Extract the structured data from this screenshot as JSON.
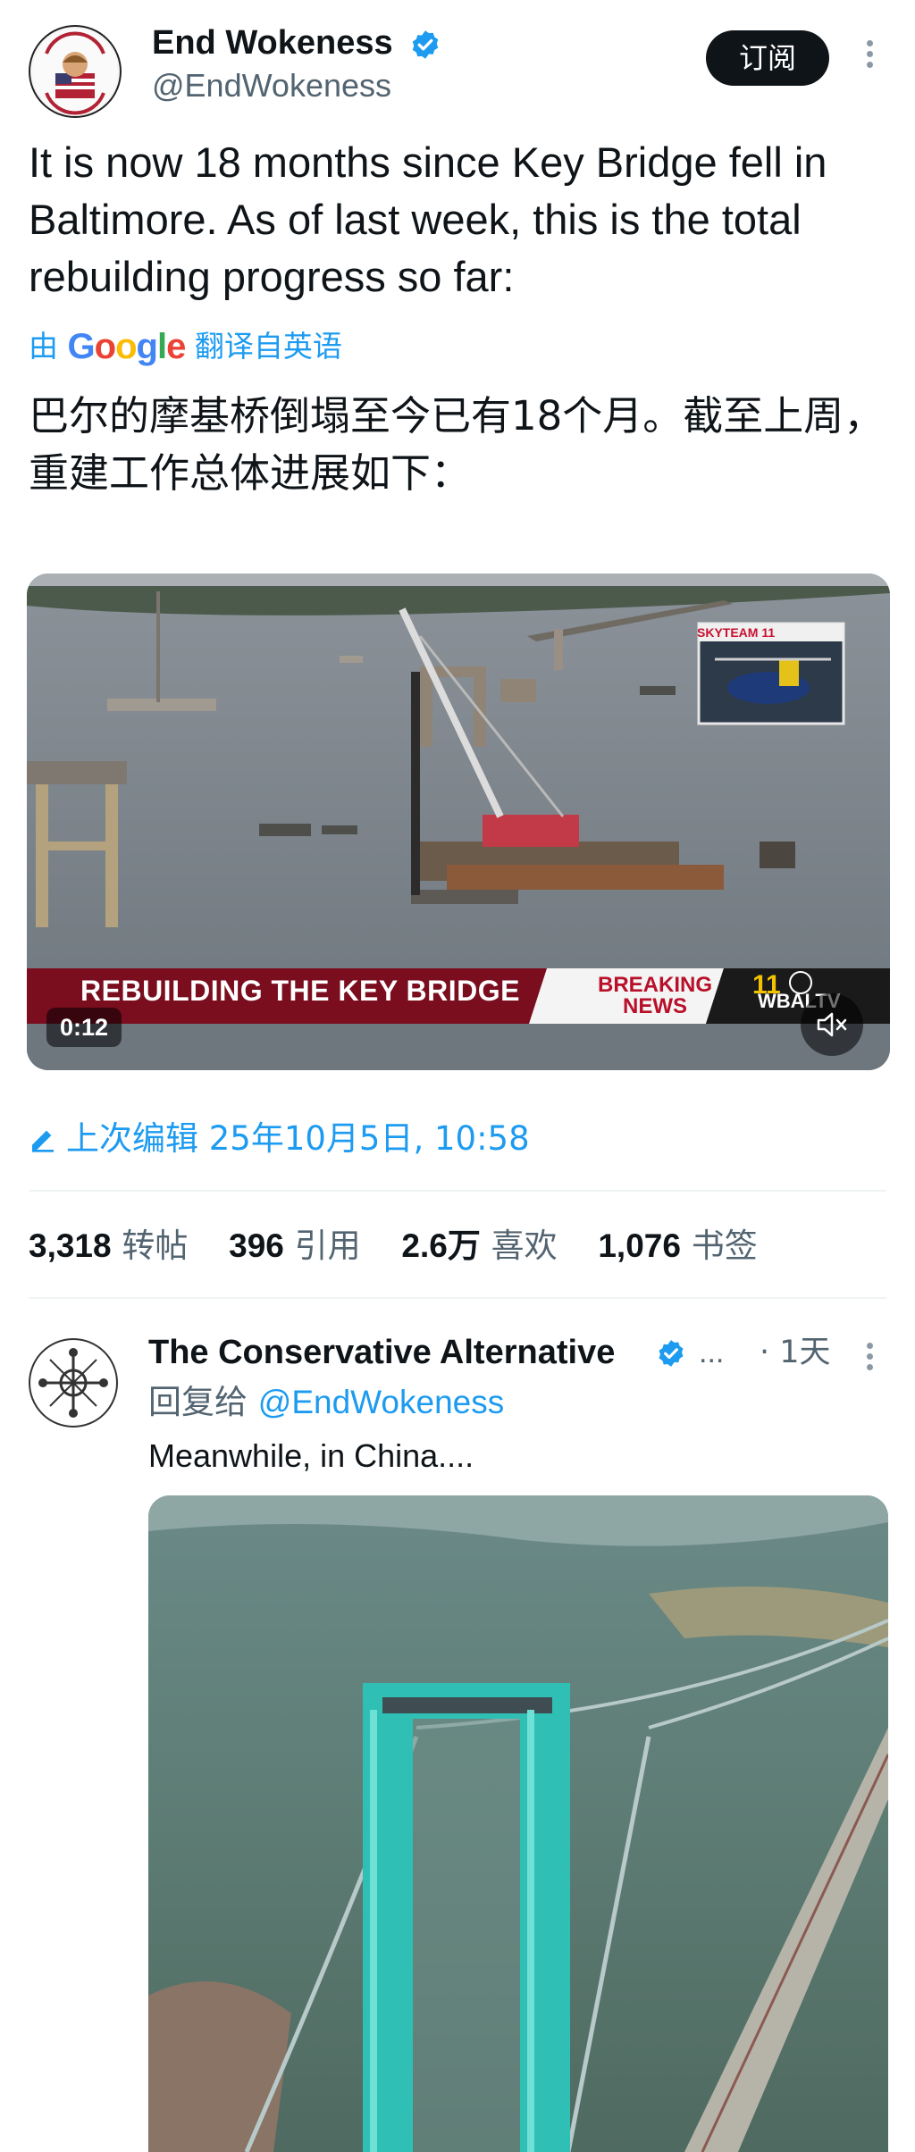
{
  "tweet": {
    "author_name": "End Wokeness",
    "author_handle": "@EndWokeness",
    "subscribe_label": "订阅",
    "text": "It is now 18 months since Key Bridge fell in Baltimore. As of last week, this is the total rebuilding progress so far:",
    "translate_prefix": "由",
    "translate_brand": "Google",
    "translate_suffix": "翻译自英语",
    "translated_text": "巴尔的摩基桥倒塌至今已有18个月。截至上周，重建工作总体进展如下：",
    "video": {
      "lower_third": "REBUILDING THE KEY BRIDGE",
      "breaking_line1": "BREAKING",
      "breaking_line2": "NEWS",
      "station": "WBALTV",
      "skyteam_label": "SKYTEAM 11",
      "duration": "0:12"
    },
    "edited": "上次编辑 25年10月5日, 10:58",
    "stats": {
      "reposts_count": "3,318",
      "reposts_label": "转帖",
      "quotes_count": "396",
      "quotes_label": "引用",
      "likes_count": "2.6万",
      "likes_label": "喜欢",
      "bookmarks_count": "1,076",
      "bookmarks_label": "书签"
    }
  },
  "reply": {
    "author_name": "The Conservative Alternative",
    "ellipsis": "...",
    "time": "· 1天",
    "reply_prefix": "回复给",
    "reply_handle": "@EndWokeness",
    "text": "Meanwhile, in China...."
  },
  "colors": {
    "accent": "#1d9bf0",
    "secondary_text": "#536471",
    "primary_text": "#0f1419",
    "news_red": "#7a0d1e"
  },
  "icons": [
    "verified-badge-icon",
    "more-options-icon",
    "edit-pencil-icon",
    "mute-icon"
  ]
}
